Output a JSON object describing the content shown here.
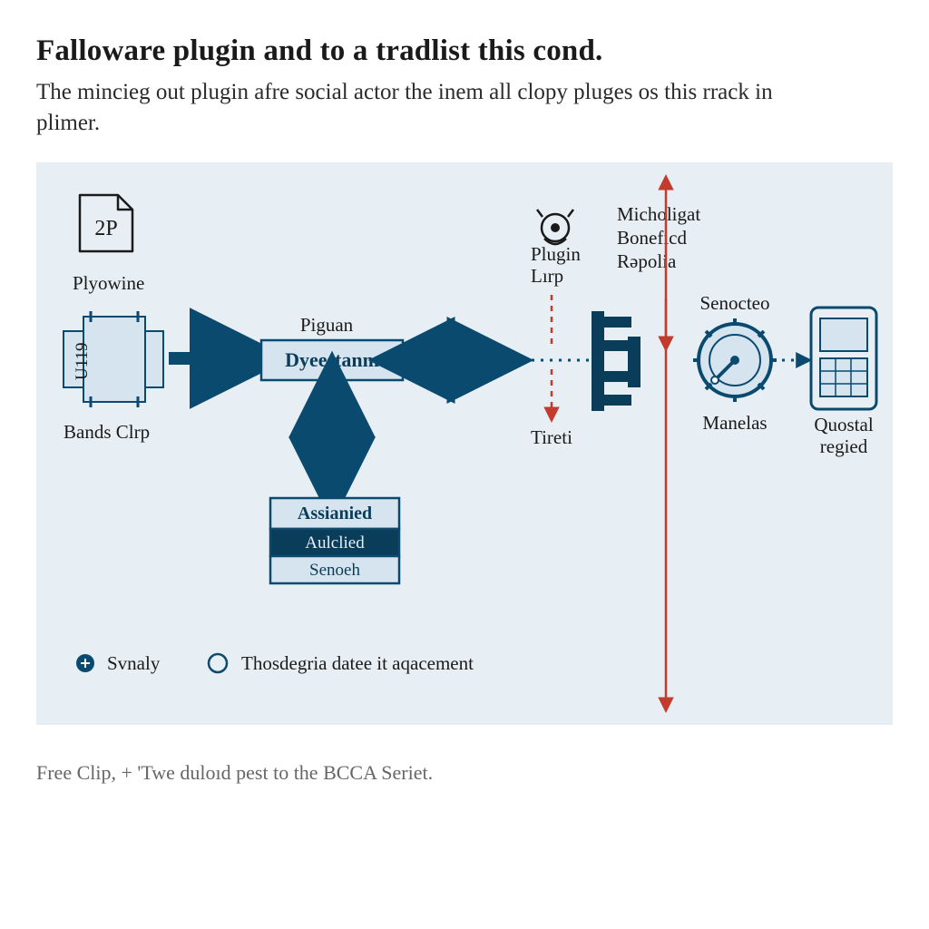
{
  "header": {
    "title": "Falloware plugin and to a tradlist this cond.",
    "subtitle": "The mincieg out plugin afre social actor the inem all clopy pluges os this rrack in plimer."
  },
  "diagram": {
    "file_badge": "2P",
    "plyowine_label": "Plyowine",
    "bands_unit": "U119",
    "bands_label": "Bands Clrp",
    "piguan_label": "Piguan",
    "dyeestanm_label": "Dyeestanm",
    "assianied": {
      "title": "Assianied",
      "row1": "Aulclied",
      "row2": "Senoeh"
    },
    "tireti_label": "Tireti",
    "plugin_lirp_line1": "Plugin",
    "plugin_lirp_line2": "Lırp",
    "micholigat_line1": "Micholigat",
    "micholigat_line2": "Boneficd",
    "micholigat_line3": "Rəpolia",
    "senocteo_label": "Senocteo",
    "manelas_label": "Manelas",
    "quostal_line1": "Quostal",
    "quostal_line2": "regied"
  },
  "legend": {
    "item1": "Svnaly",
    "item2": "Thosdegria datee it aqacement"
  },
  "footer": "Free Clip, + 'Twe duloıd pest to the BCCA Seriet."
}
